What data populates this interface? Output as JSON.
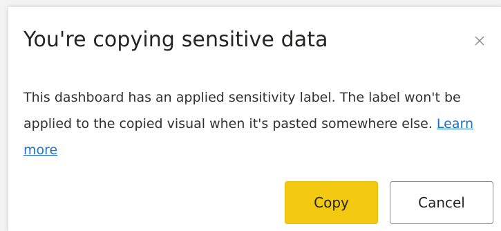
{
  "dialog": {
    "title": "You're copying sensitive data",
    "close_icon": "close-icon",
    "message": "This dashboard has an applied sensitivity label. The label won't be applied to the copied visual when it's pasted somewhere else.",
    "learn_more": "Learn more",
    "copy_label": "Copy",
    "cancel_label": "Cancel"
  },
  "colors": {
    "primary_button": "#f2c811",
    "link": "#1a73c8"
  }
}
